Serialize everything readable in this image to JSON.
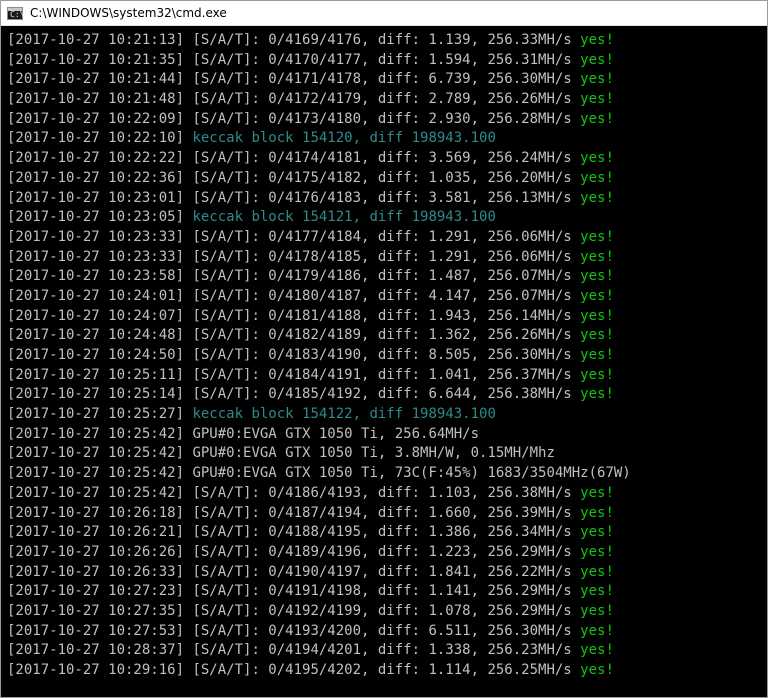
{
  "window": {
    "title": "C:\\WINDOWS\\system32\\cmd.exe",
    "icon": "cmd-icon"
  },
  "colors": {
    "background": "#000000",
    "text": "#c0c0c0",
    "accept": "#13c313",
    "block": "#2d8b8b"
  },
  "lines": [
    {
      "ts": "[2017-10-27 10:21:13]",
      "msg": " [S/A/T]: 0/4169/4176, diff: 1.139, 256.33MH/s ",
      "ok": "yes!"
    },
    {
      "ts": "[2017-10-27 10:21:35]",
      "msg": " [S/A/T]: 0/4170/4177, diff: 1.594, 256.31MH/s ",
      "ok": "yes!"
    },
    {
      "ts": "[2017-10-27 10:21:44]",
      "msg": " [S/A/T]: 0/4171/4178, diff: 6.739, 256.30MH/s ",
      "ok": "yes!"
    },
    {
      "ts": "[2017-10-27 10:21:48]",
      "msg": " [S/A/T]: 0/4172/4179, diff: 2.789, 256.26MH/s ",
      "ok": "yes!"
    },
    {
      "ts": "[2017-10-27 10:22:09]",
      "msg": " [S/A/T]: 0/4173/4180, diff: 2.930, 256.28MH/s ",
      "ok": "yes!"
    },
    {
      "ts": "[2017-10-27 10:22:10]",
      "block": " keccak block 154120, diff 198943.100"
    },
    {
      "ts": "[2017-10-27 10:22:22]",
      "msg": " [S/A/T]: 0/4174/4181, diff: 3.569, 256.24MH/s ",
      "ok": "yes!"
    },
    {
      "ts": "[2017-10-27 10:22:36]",
      "msg": " [S/A/T]: 0/4175/4182, diff: 1.035, 256.20MH/s ",
      "ok": "yes!"
    },
    {
      "ts": "[2017-10-27 10:23:01]",
      "msg": " [S/A/T]: 0/4176/4183, diff: 3.581, 256.13MH/s ",
      "ok": "yes!"
    },
    {
      "ts": "[2017-10-27 10:23:05]",
      "block": " keccak block 154121, diff 198943.100"
    },
    {
      "ts": "[2017-10-27 10:23:33]",
      "msg": " [S/A/T]: 0/4177/4184, diff: 1.291, 256.06MH/s ",
      "ok": "yes!"
    },
    {
      "ts": "[2017-10-27 10:23:33]",
      "msg": " [S/A/T]: 0/4178/4185, diff: 1.291, 256.06MH/s ",
      "ok": "yes!"
    },
    {
      "ts": "[2017-10-27 10:23:58]",
      "msg": " [S/A/T]: 0/4179/4186, diff: 1.487, 256.07MH/s ",
      "ok": "yes!"
    },
    {
      "ts": "[2017-10-27 10:24:01]",
      "msg": " [S/A/T]: 0/4180/4187, diff: 4.147, 256.07MH/s ",
      "ok": "yes!"
    },
    {
      "ts": "[2017-10-27 10:24:07]",
      "msg": " [S/A/T]: 0/4181/4188, diff: 1.943, 256.14MH/s ",
      "ok": "yes!"
    },
    {
      "ts": "[2017-10-27 10:24:48]",
      "msg": " [S/A/T]: 0/4182/4189, diff: 1.362, 256.26MH/s ",
      "ok": "yes!"
    },
    {
      "ts": "[2017-10-27 10:24:50]",
      "msg": " [S/A/T]: 0/4183/4190, diff: 8.505, 256.30MH/s ",
      "ok": "yes!"
    },
    {
      "ts": "[2017-10-27 10:25:11]",
      "msg": " [S/A/T]: 0/4184/4191, diff: 1.041, 256.37MH/s ",
      "ok": "yes!"
    },
    {
      "ts": "[2017-10-27 10:25:14]",
      "msg": " [S/A/T]: 0/4185/4192, diff: 6.644, 256.38MH/s ",
      "ok": "yes!"
    },
    {
      "ts": "[2017-10-27 10:25:27]",
      "block": " keccak block 154122, diff 198943.100"
    },
    {
      "ts": "[2017-10-27 10:25:42]",
      "msg": " GPU#0:EVGA GTX 1050 Ti, 256.64MH/s"
    },
    {
      "ts": "[2017-10-27 10:25:42]",
      "msg": " GPU#0:EVGA GTX 1050 Ti, 3.8MH/W, 0.15MH/Mhz"
    },
    {
      "ts": "[2017-10-27 10:25:42]",
      "msg": " GPU#0:EVGA GTX 1050 Ti, 73C(F:45%) 1683/3504MHz(67W)"
    },
    {
      "ts": "[2017-10-27 10:25:42]",
      "msg": " [S/A/T]: 0/4186/4193, diff: 1.103, 256.38MH/s ",
      "ok": "yes!"
    },
    {
      "ts": "[2017-10-27 10:26:18]",
      "msg": " [S/A/T]: 0/4187/4194, diff: 1.660, 256.39MH/s ",
      "ok": "yes!"
    },
    {
      "ts": "[2017-10-27 10:26:21]",
      "msg": " [S/A/T]: 0/4188/4195, diff: 1.386, 256.34MH/s ",
      "ok": "yes!"
    },
    {
      "ts": "[2017-10-27 10:26:26]",
      "msg": " [S/A/T]: 0/4189/4196, diff: 1.223, 256.29MH/s ",
      "ok": "yes!"
    },
    {
      "ts": "[2017-10-27 10:26:33]",
      "msg": " [S/A/T]: 0/4190/4197, diff: 1.841, 256.22MH/s ",
      "ok": "yes!"
    },
    {
      "ts": "[2017-10-27 10:27:23]",
      "msg": " [S/A/T]: 0/4191/4198, diff: 1.141, 256.29MH/s ",
      "ok": "yes!"
    },
    {
      "ts": "[2017-10-27 10:27:35]",
      "msg": " [S/A/T]: 0/4192/4199, diff: 1.078, 256.29MH/s ",
      "ok": "yes!"
    },
    {
      "ts": "[2017-10-27 10:27:53]",
      "msg": " [S/A/T]: 0/4193/4200, diff: 6.511, 256.30MH/s ",
      "ok": "yes!"
    },
    {
      "ts": "[2017-10-27 10:28:37]",
      "msg": " [S/A/T]: 0/4194/4201, diff: 1.338, 256.23MH/s ",
      "ok": "yes!"
    },
    {
      "ts": "[2017-10-27 10:29:16]",
      "msg": " [S/A/T]: 0/4195/4202, diff: 1.114, 256.25MH/s ",
      "ok": "yes!"
    }
  ]
}
